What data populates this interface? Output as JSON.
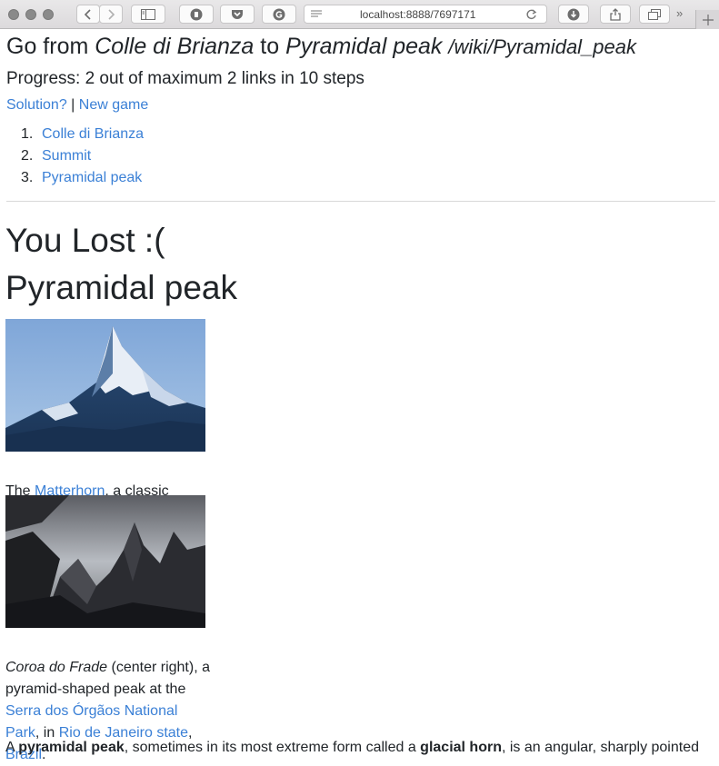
{
  "browser": {
    "url": "localhost:8888/7697171"
  },
  "header": {
    "go_from": "Go from",
    "start": "Colle di Brianza",
    "to": "to",
    "target": "Pyramidal peak",
    "route": "/wiki/Pyramidal_peak"
  },
  "progress": "Progress: 2 out of maximum 2 links in 10 steps",
  "actions": {
    "solution": "Solution?",
    "separator": "|",
    "new_game": "New game"
  },
  "steps": [
    {
      "num": "1.",
      "label": "Colle di Brianza"
    },
    {
      "num": "2.",
      "label": "Summit"
    },
    {
      "num": "3.",
      "label": "Pyramidal peak"
    }
  ],
  "result": "You Lost :(",
  "article": {
    "title": "Pyramidal peak",
    "figure1": {
      "cap_a": "The ",
      "cap_link": "Matterhorn",
      "cap_b": ", a classic example of a pyramidal peak."
    },
    "figure2": {
      "cap_italic": "Coroa do Frade",
      "cap_a": " (center right), a pyramid-shaped peak at the ",
      "cap_link1": "Serra dos Órgãos National Park",
      "cap_b": ", in ",
      "cap_link2": "Rio de Janeiro state",
      "cap_c": ", ",
      "cap_link3": "Brazil",
      "cap_d": "."
    },
    "intro": {
      "a": "A ",
      "b1": "pyramidal peak",
      "c": ", sometimes in its most extreme form called a ",
      "b2": "glacial horn",
      "d": ", is an angular, sharply pointed"
    }
  }
}
